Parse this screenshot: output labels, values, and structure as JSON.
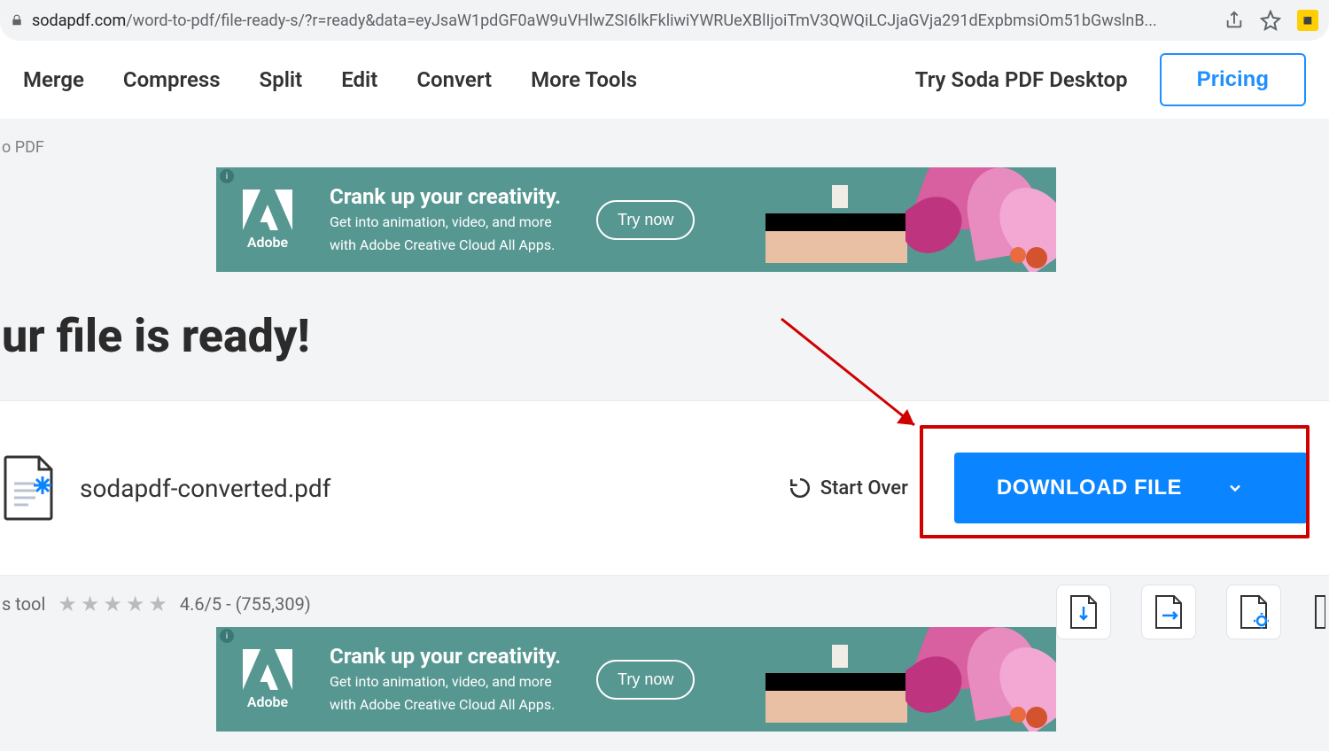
{
  "addressBar": {
    "domain": "sodapdf.com",
    "path": "/word-to-pdf/file-ready-s/?r=ready&data=eyJsaW1pdGF0aW9uVHlwZSI6lkFkliwiYWRUeXBlIjoiTmV3QWQiLCJjaGVja291dExpbmsiOm51bGwslnB..."
  },
  "nav": {
    "items": [
      "Merge",
      "Compress",
      "Split",
      "Edit",
      "Convert",
      "More Tools"
    ],
    "tryDesktop": "Try Soda PDF Desktop",
    "pricing": "Pricing"
  },
  "breadcrumb": "o PDF",
  "ad": {
    "brand": "Adobe",
    "headline": "Crank up your creativity.",
    "sub1": "Get into animation, video, and more",
    "sub2": "with Adobe Creative Cloud All Apps.",
    "cta": "Try now"
  },
  "headline": "ur file is ready!",
  "file": {
    "name": "sodapdf-converted.pdf",
    "startOver": "Start Over",
    "download": "DOWNLOAD FILE"
  },
  "rating": {
    "label": "s tool",
    "score": "4.6/5 - (755,309)"
  }
}
